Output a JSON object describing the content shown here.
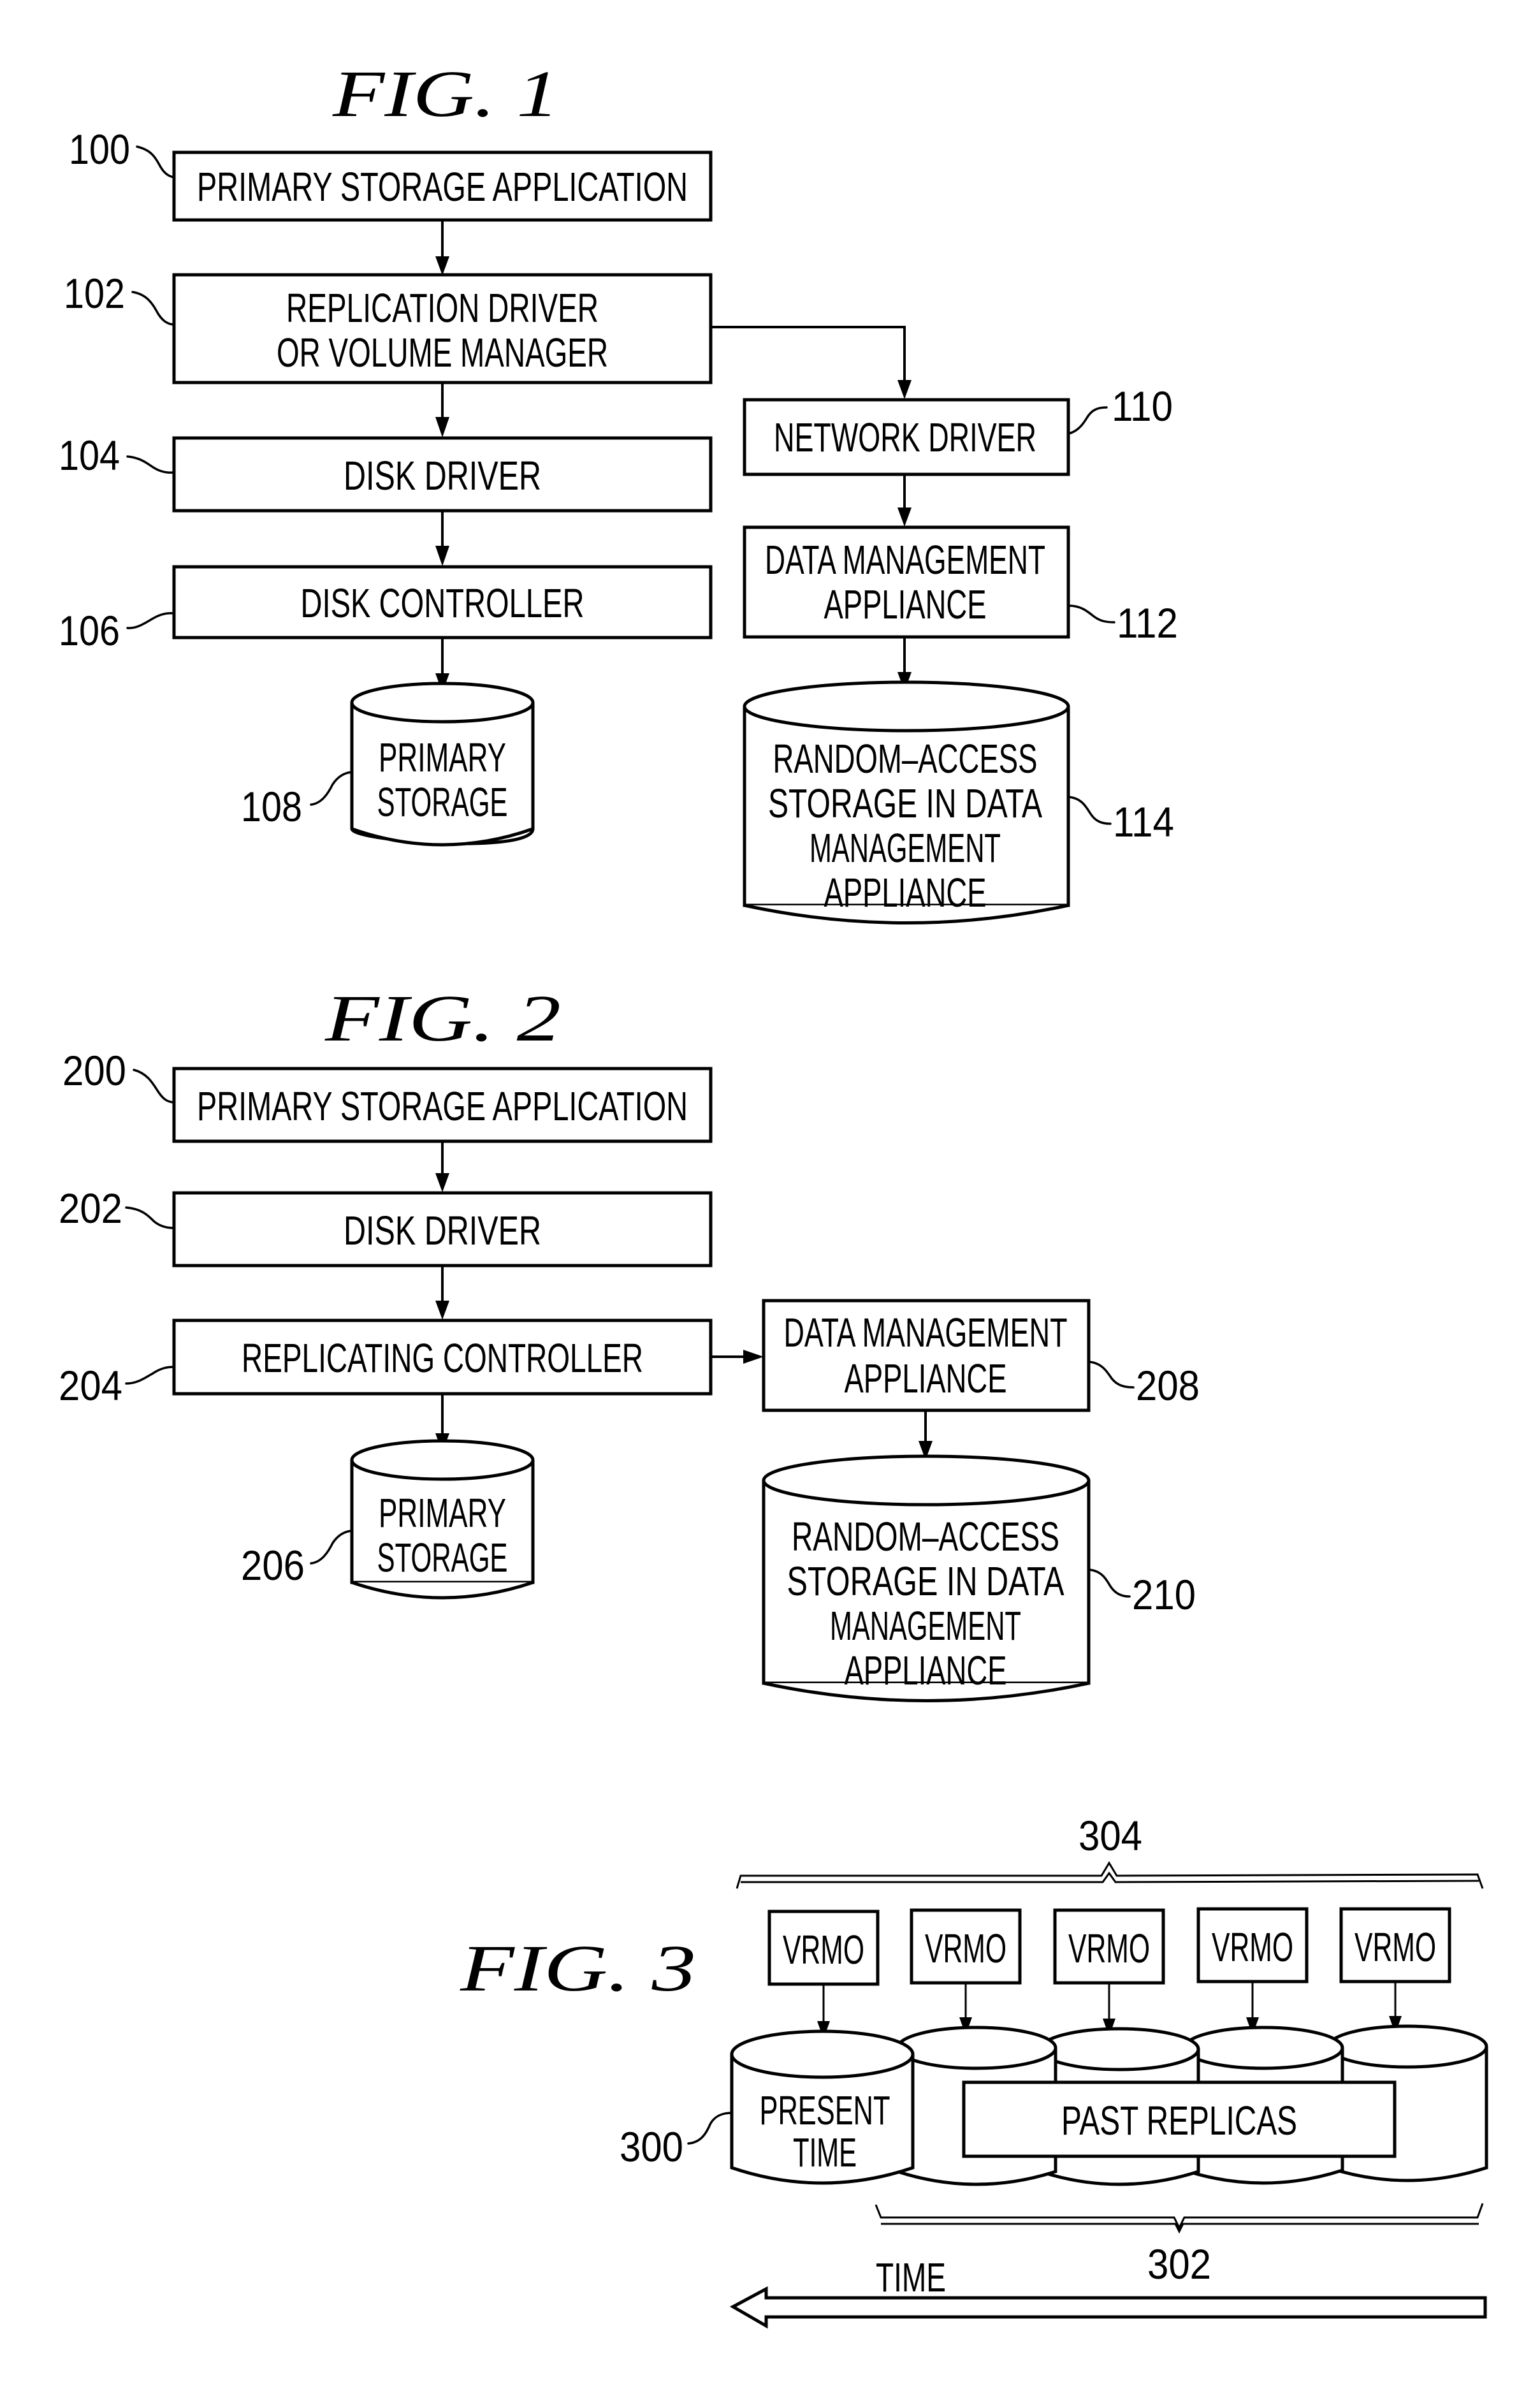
{
  "figures": {
    "fig1": {
      "title": "FIG.  1",
      "boxes": {
        "b100": {
          "ref": "100",
          "lines": [
            "PRIMARY  STORAGE  APPLICATION"
          ]
        },
        "b102": {
          "ref": "102",
          "lines": [
            "REPLICATION  DRIVER",
            "OR  VOLUME  MANAGER"
          ]
        },
        "b104": {
          "ref": "104",
          "lines": [
            "DISK  DRIVER"
          ]
        },
        "b106": {
          "ref": "106",
          "lines": [
            "DISK  CONTROLLER"
          ]
        },
        "b110": {
          "ref": "110",
          "lines": [
            "NETWORK  DRIVER"
          ]
        },
        "b112": {
          "ref": "112",
          "lines": [
            "DATA  MANAGEMENT",
            "APPLIANCE"
          ]
        }
      },
      "cylinders": {
        "c108": {
          "ref": "108",
          "lines": [
            "PRIMARY",
            "STORAGE"
          ]
        },
        "c114": {
          "ref": "114",
          "lines": [
            "RANDOM–ACCESS",
            "STORAGE  IN  DATA",
            "MANAGEMENT",
            "APPLIANCE"
          ]
        }
      }
    },
    "fig2": {
      "title": "FIG.  2",
      "boxes": {
        "b200": {
          "ref": "200",
          "lines": [
            "PRIMARY  STORAGE  APPLICATION"
          ]
        },
        "b202": {
          "ref": "202",
          "lines": [
            "DISK  DRIVER"
          ]
        },
        "b204": {
          "ref": "204",
          "lines": [
            "REPLICATING  CONTROLLER"
          ]
        },
        "b208": {
          "ref": "208",
          "lines": [
            "DATA  MANAGEMENT",
            "APPLIANCE"
          ]
        }
      },
      "cylinders": {
        "c206": {
          "ref": "206",
          "lines": [
            "PRIMARY",
            "STORAGE"
          ]
        },
        "c210": {
          "ref": "210",
          "lines": [
            "RANDOM–ACCESS",
            "STORAGE  IN  DATA",
            "MANAGEMENT",
            "APPLIANCE"
          ]
        }
      }
    },
    "fig3": {
      "title": "FIG.  3",
      "vrmo_label": "VRMO",
      "vrmo_count": 5,
      "present": {
        "ref": "300",
        "lines": [
          "PRESENT",
          "TIME"
        ]
      },
      "past_replicas": {
        "ref": "302",
        "label": "PAST  REPLICAS"
      },
      "group_ref": "304",
      "time_label": "TIME",
      "time_direction": "left"
    }
  }
}
